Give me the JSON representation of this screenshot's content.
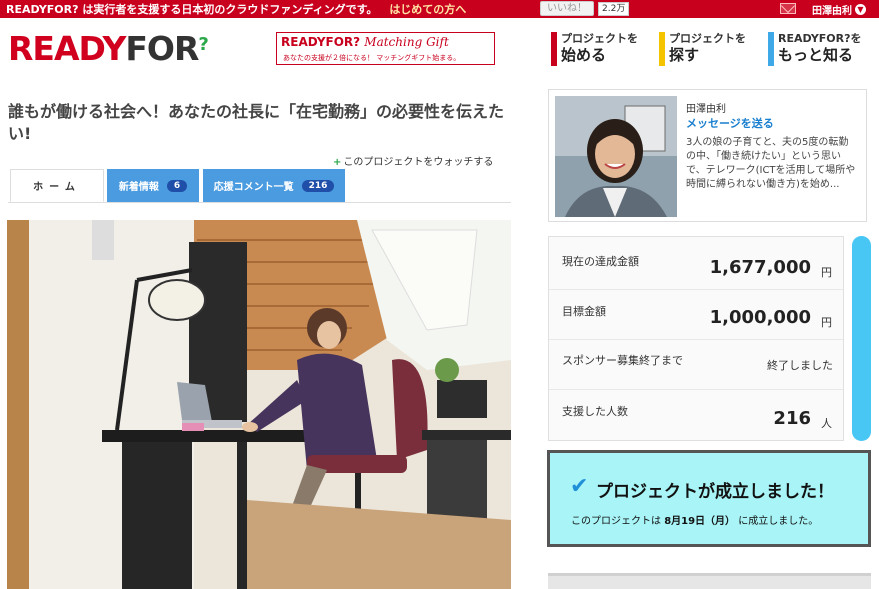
{
  "topbar": {
    "message": "READYFOR? は実行者を支援する日本初のクラウドファンディングです。",
    "first_link": "はじめての方へ",
    "like_label": "いいね！",
    "like_count": "2.2万",
    "user_name": "田澤由利",
    "caret": "▼"
  },
  "header": {
    "logo_ready": "READY",
    "logo_for": "FOR",
    "logo_q": "?",
    "matching_title": "READYFOR?",
    "matching_script": "Matching Gift",
    "matching_sub": "あなたの支援が２倍になる！ マッチングギフト始まる。",
    "nav": [
      {
        "small": "プロジェクトを",
        "big": "始める",
        "color": "#c8001e"
      },
      {
        "small": "プロジェクトを",
        "big": "探す",
        "color": "#f5c400"
      },
      {
        "small": "READYFOR?を",
        "big": "もっと知る",
        "color": "#3fa9e8"
      }
    ]
  },
  "project": {
    "title": "誰もが働ける社会へ！あなたの社長に「在宅勤務」の必要性を伝えたい!",
    "watch_plus": "+",
    "watch_label": "このプロジェクトをウォッチする"
  },
  "tabs": [
    {
      "label": "ホーム"
    },
    {
      "label": "新着情報",
      "badge": "6"
    },
    {
      "label": "応援コメント一覧",
      "badge": "216"
    }
  ],
  "owner": {
    "name": "田澤由利",
    "message_link": "メッセージを送る",
    "description": "3人の娘の子育てと、夫の5度の転勤の中、「働き続けたい」という思いで、テレワーク(ICTを活用して場所や時間に縛られない働き方)を始め..."
  },
  "stats": {
    "raised_label": "現在の達成金額",
    "raised_value": "1,677,000",
    "goal_label": "目標金額",
    "goal_value": "1,000,000",
    "yen": "円",
    "deadline_label": "スポンサー募集終了まで",
    "deadline_value": "終了しました",
    "backers_label": "支援した人数",
    "backers_value": "216",
    "people_unit": "人"
  },
  "success": {
    "check": "✔",
    "heading": "プロジェクトが成立しました！",
    "note_prefix": "このプロジェクトは",
    "note_date": "8月19日（月）",
    "note_suffix": "に成立しました。"
  }
}
